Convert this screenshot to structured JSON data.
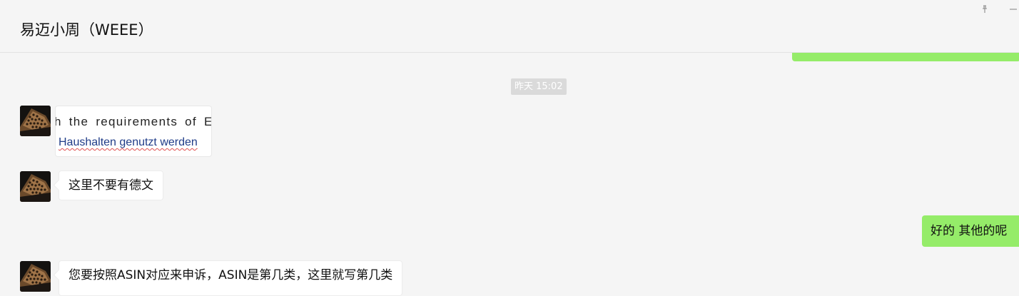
{
  "window": {
    "title": "易迈小周（WEEE）",
    "pin_icon": "pin-icon",
    "minimize_icon": "minimize-icon"
  },
  "colors": {
    "background": "#f5f5f5",
    "outgoing_bubble": "#95ec69",
    "incoming_bubble": "#ffffff",
    "timestamp_bg": "#dadada"
  },
  "messages": {
    "timestamp": "昨天 15:02",
    "image_message": {
      "line1": "h the requirements of EA",
      "line2": "Haushalten genutzt werden"
    },
    "msg1": {
      "text": "这里不要有德文"
    },
    "msg2": {
      "text": "好的  其他的呢"
    },
    "msg3": {
      "text": "您要按照ASIN对应来申诉，ASIN是第几类，这里就写第几类"
    }
  }
}
